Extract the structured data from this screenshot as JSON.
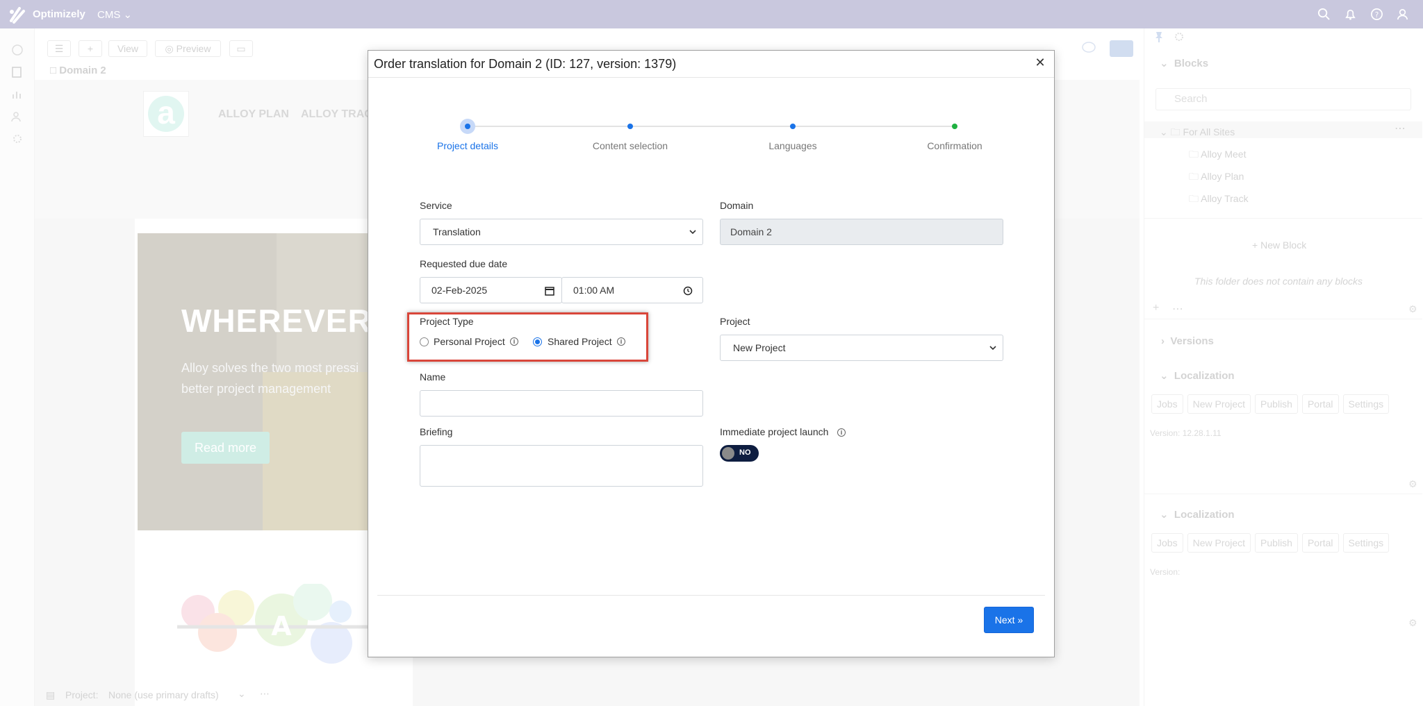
{
  "topbar": {
    "brand": "Optimizely",
    "product": "CMS",
    "icons": [
      "search-icon",
      "bell-icon",
      "help-icon",
      "user-icon"
    ]
  },
  "toolbar": {
    "view_label": "View",
    "preview_label": "Preview"
  },
  "breadcrumb": {
    "page": "Domain 2"
  },
  "site_preview": {
    "nav": [
      "ALLOY PLAN",
      "ALLOY TRAC"
    ],
    "hero_title": "WHEREVER",
    "hero_text": "Alloy solves the two most pressi better project management",
    "hero_button": "Read more"
  },
  "right_panel": {
    "blocks_title": "Blocks",
    "search_placeholder": "Search",
    "tree_root": "For All Sites",
    "tree_items": [
      "Alloy Meet",
      "Alloy Plan",
      "Alloy Track"
    ],
    "new_block": "New Block",
    "empty_message": "This folder does not contain any blocks",
    "versions_title": "Versions",
    "localization_title": "Localization",
    "loc_buttons": [
      "Jobs",
      "New Project",
      "Publish",
      "Portal",
      "Settings"
    ],
    "version_text": "Version: 12.28.1.11",
    "version_text_2": "Version:"
  },
  "bottombar": {
    "project_label": "Project:",
    "project_value": "None (use primary drafts)"
  },
  "modal": {
    "title": "Order translation for Domain 2 (ID: 127, version: 1379)",
    "steps": [
      "Project details",
      "Content selection",
      "Languages",
      "Confirmation"
    ],
    "service_label": "Service",
    "service_value": "Translation",
    "domain_label": "Domain",
    "domain_value": "Domain 2",
    "due_label": "Requested due date",
    "due_date": "02-Feb-2025",
    "due_time": "01:00 AM",
    "project_type_label": "Project Type",
    "personal_project": "Personal Project",
    "shared_project": "Shared Project",
    "project_label": "Project",
    "project_value": "New Project",
    "name_label": "Name",
    "name_value": "",
    "briefing_label": "Briefing",
    "briefing_value": "",
    "launch_label": "Immediate project launch",
    "launch_value": "NO",
    "next_label": "Next »"
  },
  "colors": {
    "primary": "#1a73e8",
    "confirm_step": "#1fb141",
    "highlight": "#d9463a",
    "toggle_bg": "#0e1d40"
  }
}
